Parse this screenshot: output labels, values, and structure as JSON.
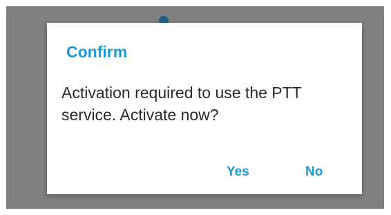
{
  "dialog": {
    "title": "Confirm",
    "message": "Activation required to use the PTT service. Activate now?",
    "positive_label": "Yes",
    "negative_label": "No"
  },
  "colors": {
    "accent": "#1b9ad6",
    "scrim": "#808080",
    "dialog_background": "#ffffff",
    "message_text": "#2a2a2a"
  }
}
